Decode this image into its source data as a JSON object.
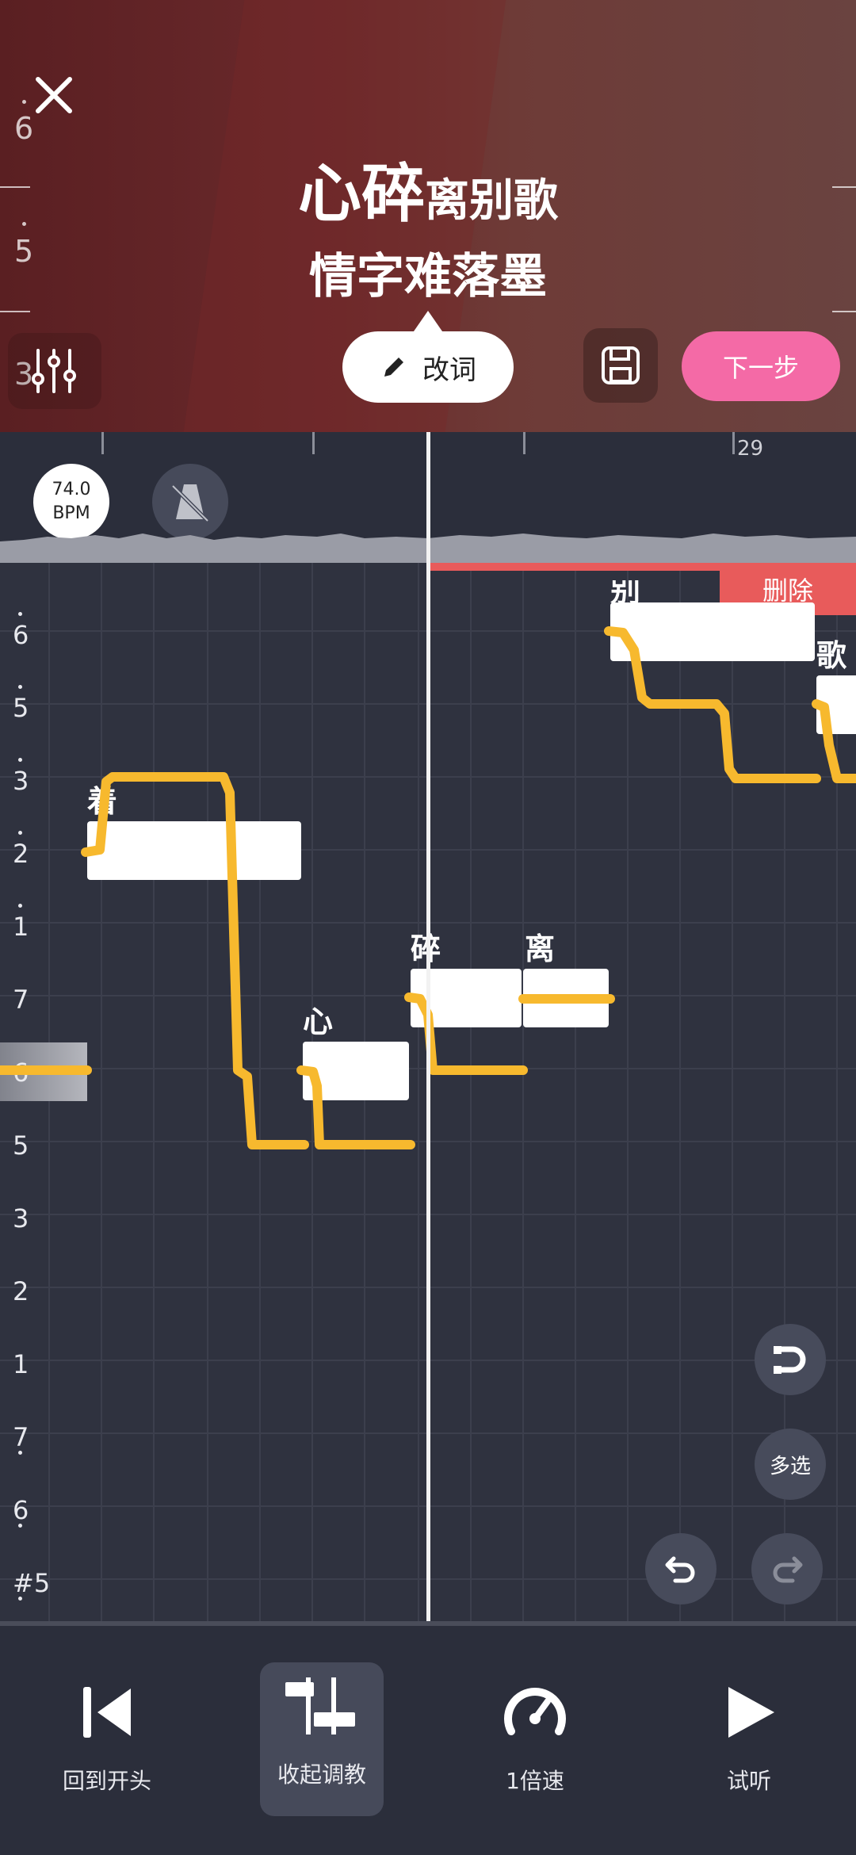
{
  "header": {
    "left_scale": [
      "6",
      "5",
      "3"
    ],
    "lyric_line1_big": "心碎",
    "lyric_line1_small": "离别歌",
    "lyric_line2": "情字难落墨",
    "edit_label": "改词",
    "next_label": "下一步"
  },
  "timeline": {
    "bpm_value": "74.0",
    "bpm_unit": "BPM",
    "bar_label": "29"
  },
  "roll": {
    "scale": [
      "6",
      "5",
      "3",
      "2",
      "1",
      "7",
      "6",
      "5",
      "3",
      "2",
      "1",
      "7",
      "6",
      "#5"
    ],
    "syllables": [
      "着",
      "心",
      "碎",
      "离",
      "别",
      "歌"
    ],
    "delete_label": "删除",
    "multiselect_label": "多选"
  },
  "bottom": {
    "items": [
      {
        "label": "回到开头"
      },
      {
        "label": "收起调教"
      },
      {
        "label": "1倍速"
      },
      {
        "label": "试听"
      }
    ]
  },
  "colors": {
    "accent_pink": "#f46aa6",
    "pitch_curve": "#f7b92e",
    "delete_red": "#e85b5b"
  }
}
